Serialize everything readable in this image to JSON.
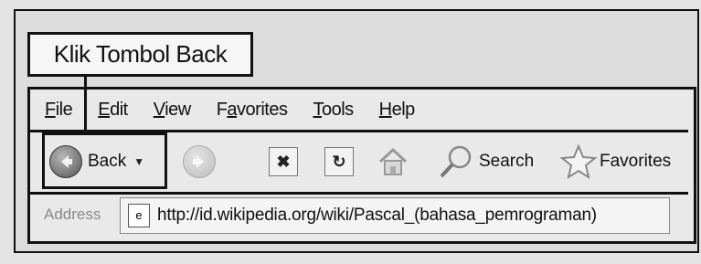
{
  "callout": {
    "text": "Klik Tombol Back"
  },
  "menu": [
    {
      "ul": "F",
      "rest": "ile"
    },
    {
      "ul": "E",
      "rest": "dit"
    },
    {
      "ul": "V",
      "rest": "iew"
    },
    {
      "ul": "a",
      "pre": "F",
      "rest": "vorites"
    },
    {
      "ul": "T",
      "rest": "ools"
    },
    {
      "ul": "H",
      "rest": "elp"
    }
  ],
  "toolbar": {
    "back_label": "Back",
    "search_label": "Search",
    "favorites_label": "Favorites"
  },
  "address": {
    "label": "Address",
    "url": "http://id.wikipedia.org/wiki/Pascal_(bahasa_pemrograman)"
  }
}
